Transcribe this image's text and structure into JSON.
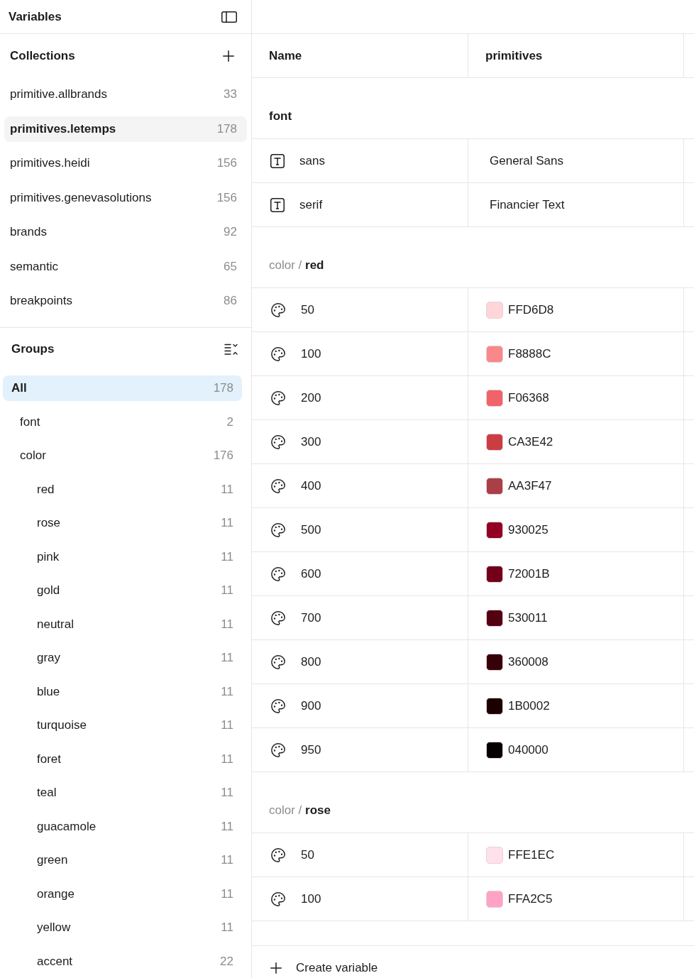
{
  "sidebar": {
    "title": "Variables"
  },
  "collections": {
    "title": "Collections",
    "items": [
      {
        "name": "primitive.allbrands",
        "count": "33",
        "selected": false
      },
      {
        "name": "primitives.letemps",
        "count": "178",
        "selected": true
      },
      {
        "name": "primitives.heidi",
        "count": "156",
        "selected": false
      },
      {
        "name": "primitives.genevasolutions",
        "count": "156",
        "selected": false
      },
      {
        "name": "brands",
        "count": "92",
        "selected": false
      },
      {
        "name": "semantic",
        "count": "65",
        "selected": false
      },
      {
        "name": "breakpoints",
        "count": "86",
        "selected": false
      }
    ]
  },
  "groups": {
    "title": "Groups",
    "items": [
      {
        "name": "All",
        "count": "178",
        "selected": true,
        "children": [
          {
            "name": "font",
            "count": "2",
            "selected": false
          },
          {
            "name": "color",
            "count": "176",
            "selected": false,
            "children": [
              {
                "name": "red",
                "count": "11",
                "selected": false
              },
              {
                "name": "rose",
                "count": "11",
                "selected": false
              },
              {
                "name": "pink",
                "count": "11",
                "selected": false
              },
              {
                "name": "gold",
                "count": "11",
                "selected": false
              },
              {
                "name": "neutral",
                "count": "11",
                "selected": false
              },
              {
                "name": "gray",
                "count": "11",
                "selected": false
              },
              {
                "name": "blue",
                "count": "11",
                "selected": false
              },
              {
                "name": "turquoise",
                "count": "11",
                "selected": false
              },
              {
                "name": "foret",
                "count": "11",
                "selected": false
              },
              {
                "name": "teal",
                "count": "11",
                "selected": false
              },
              {
                "name": "guacamole",
                "count": "11",
                "selected": false
              },
              {
                "name": "green",
                "count": "11",
                "selected": false
              },
              {
                "name": "orange",
                "count": "11",
                "selected": false
              },
              {
                "name": "yellow",
                "count": "11",
                "selected": false
              },
              {
                "name": "accent",
                "count": "22",
                "selected": false
              }
            ]
          }
        ]
      }
    ]
  },
  "table": {
    "columns": [
      "Name",
      "primitives"
    ],
    "sections": [
      {
        "title": "font",
        "variables": [
          {
            "kind": "text",
            "name": "sans",
            "value": "General Sans"
          },
          {
            "kind": "text",
            "name": "serif",
            "value": "Financier Text"
          }
        ]
      },
      {
        "prefix": "color /",
        "title": "red",
        "variables": [
          {
            "kind": "color",
            "name": "50",
            "value": "FFD6D8",
            "color": "#ffd6d8"
          },
          {
            "kind": "color",
            "name": "100",
            "value": "F8888C",
            "color": "#f8888c"
          },
          {
            "kind": "color",
            "name": "200",
            "value": "F06368",
            "color": "#f06368"
          },
          {
            "kind": "color",
            "name": "300",
            "value": "CA3E42",
            "color": "#ca3e42"
          },
          {
            "kind": "color",
            "name": "400",
            "value": "AA3F47",
            "color": "#aa3f47"
          },
          {
            "kind": "color",
            "name": "500",
            "value": "930025",
            "color": "#930025"
          },
          {
            "kind": "color",
            "name": "600",
            "value": "72001B",
            "color": "#72001b"
          },
          {
            "kind": "color",
            "name": "700",
            "value": "530011",
            "color": "#530011"
          },
          {
            "kind": "color",
            "name": "800",
            "value": "360008",
            "color": "#360008"
          },
          {
            "kind": "color",
            "name": "900",
            "value": "1B0002",
            "color": "#1b0002"
          },
          {
            "kind": "color",
            "name": "950",
            "value": "040000",
            "color": "#040000"
          }
        ]
      },
      {
        "prefix": "color /",
        "title": "rose",
        "variables": [
          {
            "kind": "color",
            "name": "50",
            "value": "FFE1EC",
            "color": "#ffe1ec"
          },
          {
            "kind": "color",
            "name": "100",
            "value": "FFA2C5",
            "color": "#ffa2c5"
          }
        ]
      }
    ]
  },
  "footer": {
    "action": "Create variable"
  }
}
